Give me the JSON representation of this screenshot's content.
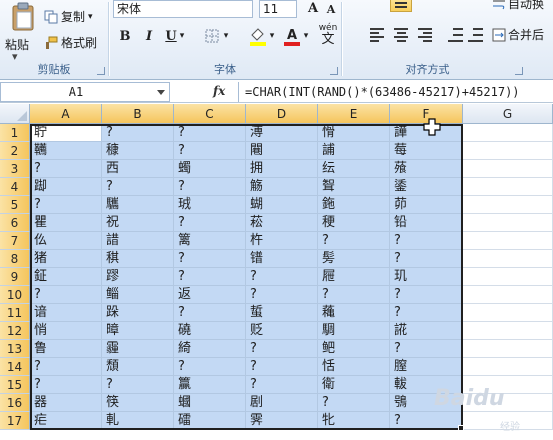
{
  "ribbon": {
    "clipboard": {
      "label": "剪贴板",
      "paste": "粘贴",
      "copy": "复制",
      "format_painter": "格式刷"
    },
    "font": {
      "label": "字体",
      "font_name": "宋体",
      "font_size": "11",
      "bold": "B",
      "italic": "I",
      "underline": "U",
      "wen": "wén",
      "wen_sub": "文"
    },
    "alignment": {
      "label": "对齐方式",
      "wrap_text": "自动换",
      "merge_center": "合并后"
    }
  },
  "formula_bar": {
    "name_box": "A1",
    "fx": "fx",
    "formula": "=CHAR(INT(RAND()*(63486-45217)+45217))"
  },
  "grid": {
    "columns": [
      "A",
      "B",
      "C",
      "D",
      "E",
      "F",
      "G"
    ],
    "rows": [
      "1",
      "2",
      "3",
      "4",
      "5",
      "6",
      "7",
      "8",
      "9",
      "10",
      "11",
      "12",
      "13",
      "14",
      "15",
      "16",
      "17"
    ],
    "cells": [
      [
        "聍",
        "?",
        "?",
        "溥",
        "愲",
        "譁"
      ],
      [
        "韉",
        "穅",
        "?",
        "闀",
        "誧",
        "莓"
      ],
      [
        "?",
        "西",
        "蠋",
        "拥",
        "纭",
        "蕵"
      ],
      [
        "踋",
        "?",
        "?",
        "觞",
        "聟",
        "鋈"
      ],
      [
        "?",
        "驨",
        "珬",
        "蝴",
        "鉇",
        "茆"
      ],
      [
        "瞿",
        "祝",
        "?",
        "菘",
        "稉",
        "铅"
      ],
      [
        "仫",
        "諎",
        "篱",
        "杵",
        "?",
        "?"
      ],
      [
        "猪",
        "稘",
        "?",
        "镨",
        "髣",
        "?"
      ],
      [
        "鉦",
        "蹘",
        "?",
        "?",
        "屜",
        "玑"
      ],
      [
        "?",
        "鲻",
        "返",
        "?",
        "?",
        "?"
      ],
      [
        "谙",
        "跺",
        "?",
        "蜇",
        "蘒",
        "?"
      ],
      [
        "悄",
        "暲",
        "磽",
        "贬",
        "騆",
        "誮"
      ],
      [
        "鲁",
        "霾",
        "綺",
        "?",
        "鲃",
        "?"
      ],
      [
        "?",
        "頹",
        "?",
        "?",
        "恬",
        "膣"
      ],
      [
        "?",
        "?",
        "籯",
        "?",
        "衛",
        "軷"
      ],
      [
        "器",
        "筷",
        "蟈",
        "剧",
        "?",
        "鴞"
      ],
      [
        "疟",
        "軋",
        "礌",
        "霁",
        "牝",
        "?"
      ]
    ]
  },
  "watermark": {
    "brand": "Baidu",
    "sub": "经验"
  },
  "colors": {
    "selection": "#c3d9f4",
    "header_selected": "#f5c55d",
    "ribbon_label": "#3a5f8a"
  }
}
